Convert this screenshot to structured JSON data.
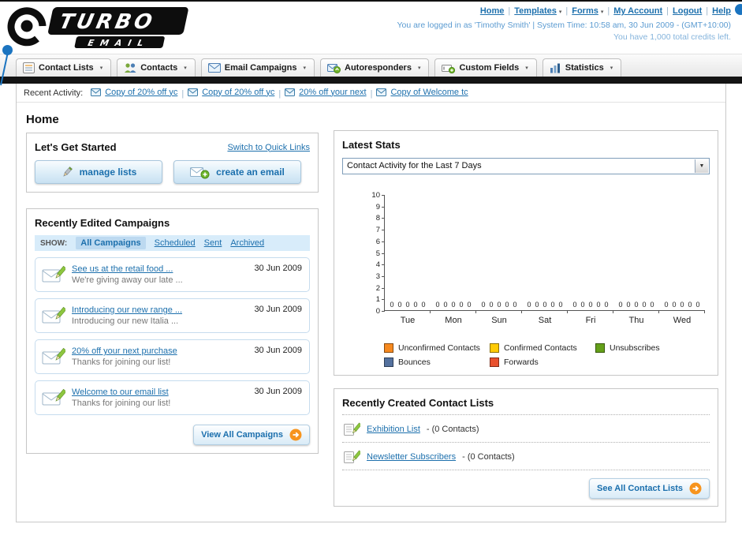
{
  "page_title": "Home",
  "colors": {
    "link_blue": "#1d70ad",
    "accent_orange": "#f7941d",
    "nav_bar_dark": "#141414"
  },
  "header": {
    "logo_title": "TURBO",
    "logo_subtitle": "EMAIL",
    "nav_links": [
      {
        "label": "Home",
        "dropdown": false
      },
      {
        "label": "Templates",
        "dropdown": true
      },
      {
        "label": "Forms",
        "dropdown": true
      },
      {
        "label": "My Account",
        "dropdown": false
      },
      {
        "label": "Logout",
        "dropdown": false
      },
      {
        "label": "Help",
        "dropdown": false
      }
    ],
    "login_info": "You are logged in as 'Timothy Smith' | System Time: 10:58 am, 30 Jun 2009 - (GMT+10:00)",
    "credits_info": "You have 1,000 total credits left."
  },
  "main_nav": [
    {
      "label": "Contact Lists",
      "icon": "contact-lists-icon"
    },
    {
      "label": "Contacts",
      "icon": "contacts-icon"
    },
    {
      "label": "Email Campaigns",
      "icon": "email-campaigns-icon"
    },
    {
      "label": "Autoresponders",
      "icon": "autoresponders-icon"
    },
    {
      "label": "Custom Fields",
      "icon": "custom-fields-icon"
    },
    {
      "label": "Statistics",
      "icon": "statistics-icon"
    }
  ],
  "recent_activity": {
    "label": "Recent Activity:",
    "items": [
      {
        "label": "Copy of 20% off yc",
        "icon": "email-icon"
      },
      {
        "label": "Copy of 20% off yc",
        "icon": "email-icon"
      },
      {
        "label": "20% off your next",
        "icon": "email-icon"
      },
      {
        "label": "Copy of Welcome tc",
        "icon": "email-icon"
      }
    ]
  },
  "get_started": {
    "title": "Let's Get Started",
    "switch_link": "Switch to Quick Links",
    "manage_lists_label": "manage lists",
    "create_email_label": "create an email"
  },
  "campaigns": {
    "title": "Recently Edited Campaigns",
    "show_label": "SHOW:",
    "filters": [
      "All Campaigns",
      "Scheduled",
      "Sent",
      "Archived"
    ],
    "selected_filter": "All Campaigns",
    "items": [
      {
        "title": "See us at the retail food ...",
        "subtitle": "We're giving away our late ...",
        "date": "30 Jun 2009"
      },
      {
        "title": "Introducing our new range ...",
        "subtitle": "Introducing our new Italia ...",
        "date": "30 Jun 2009"
      },
      {
        "title": "20% off your next purchase",
        "subtitle": "Thanks for joining our list!",
        "date": "30 Jun 2009"
      },
      {
        "title": "Welcome to our email list",
        "subtitle": "Thanks for joining our list!",
        "date": "30 Jun 2009"
      }
    ],
    "view_all_label": "View All Campaigns"
  },
  "latest_stats": {
    "title": "Latest Stats",
    "selected_option": "Contact Activity for the Last 7 Days",
    "chart_data": {
      "type": "bar",
      "title": "Contact Activity for the Last 7 Days",
      "categories": [
        "Tue",
        "Mon",
        "Sun",
        "Sat",
        "Fri",
        "Thu",
        "Wed"
      ],
      "series": [
        {
          "name": "Unconfirmed Contacts",
          "color": "#f6891f",
          "values": [
            0,
            0,
            0,
            0,
            0,
            0,
            0
          ]
        },
        {
          "name": "Confirmed Contacts",
          "color": "#ffcb05",
          "values": [
            0,
            0,
            0,
            0,
            0,
            0,
            0
          ]
        },
        {
          "name": "Unsubscribes",
          "color": "#64a019",
          "values": [
            0,
            0,
            0,
            0,
            0,
            0,
            0
          ]
        },
        {
          "name": "Bounces",
          "color": "#54719e",
          "values": [
            0,
            0,
            0,
            0,
            0,
            0,
            0
          ]
        },
        {
          "name": "Forwards",
          "color": "#e9512e",
          "values": [
            0,
            0,
            0,
            0,
            0,
            0,
            0
          ]
        }
      ],
      "ylim": [
        0,
        10
      ],
      "yticks": [
        0,
        1,
        2,
        3,
        4,
        5,
        6,
        7,
        8,
        9,
        10
      ],
      "legend_position": "bottom",
      "grid": false
    }
  },
  "contact_lists": {
    "title": "Recently Created Contact Lists",
    "items": [
      {
        "name": "Exhibition List",
        "detail": "- (0 Contacts)"
      },
      {
        "name": "Newsletter Subscribers",
        "detail": "- (0 Contacts)"
      }
    ],
    "see_all_label": "See All Contact Lists"
  }
}
